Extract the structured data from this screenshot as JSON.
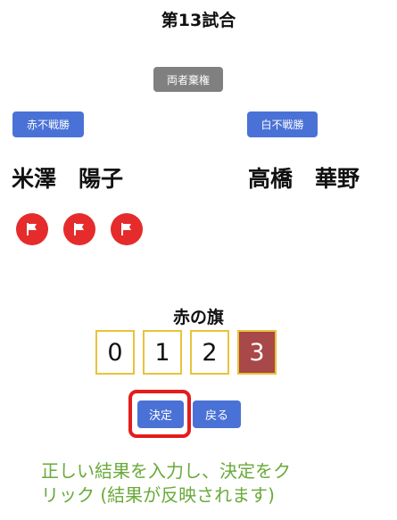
{
  "match": {
    "title": "第13試合"
  },
  "actions": {
    "both_abstain_label": "両者棄権",
    "red_default_win_label": "赤不戦勝",
    "white_default_win_label": "白不戦勝"
  },
  "players": {
    "red_name": "米澤　陽子",
    "white_name": "高橋　華野"
  },
  "flags": {
    "red_count": 3,
    "icon": "flag-icon",
    "color": "#e52b2b"
  },
  "selector": {
    "label": "赤の旗",
    "options": [
      "0",
      "1",
      "2",
      "3"
    ],
    "selected": "3"
  },
  "controls": {
    "confirm_label": "決定",
    "back_label": "戻る"
  },
  "hint": {
    "line1": "正しい結果を入力し、決定をク",
    "line2": "リック (結果が反映されます)"
  },
  "colors": {
    "accent_blue": "#4a72d6",
    "gray": "#808080",
    "selected_digit": "#a84848",
    "digit_border": "#e8c33b",
    "highlight_red": "#e41c1c",
    "hint_green": "#6aaa3a"
  }
}
